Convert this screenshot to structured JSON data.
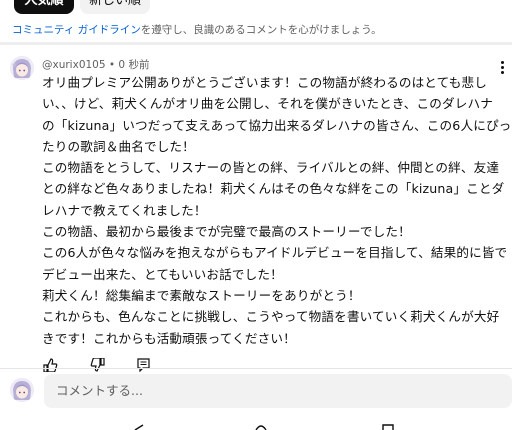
{
  "sort_chips": {
    "popular": "人気順",
    "newest": "新しい順"
  },
  "guidelines": {
    "link_text": "コミュニティ ガイドライン",
    "rest_text": "を遵守し、良識のあるコメントを心がけましょう。"
  },
  "comment": {
    "author": "@xurix0105",
    "separator": " • ",
    "time": "0 秒前",
    "lines": [
      "オリ曲プレミア公開ありがとうございます！この物語が終わるのはとても悲し",
      "い、、けど、莉犬くんがオリ曲を公開し、それを僕がきいたとき、このダレハナ",
      "の「kizuna」いつだって支えあって協力出来るダレハナの皆さん、この6人にぴっ",
      "たりの歌詞＆曲名でした！",
      "この物語をとうして、リスナーの皆との絆、ライバルとの絆、仲間との絆、友達",
      "との絆など色々ありましたね！莉犬くんはその色々な絆をこの「kizuna」ことダ",
      "レハナで教えてくれました！",
      "この物語、最初から最後までが完璧で最高のストーリーでした！",
      "この6人が色々な悩みを抱えながらもアイドルデビューを目指して、結果的に皆で",
      "デビュー出来た、とてもいいお話でした！",
      "莉犬くん！総集編まで素敵なストーリーをありがとう！",
      "これからも、色んなことに挑戦し、こうやって物語を書いていく莉犬くんが大好",
      "きです！これからも活動頑張ってください！"
    ]
  },
  "input": {
    "placeholder": "コメントする..."
  },
  "icons": {
    "like": "thumbs-up-icon",
    "dislike": "thumbs-down-icon",
    "reply": "reply-icon",
    "more": "more-vertical-icon"
  },
  "colors": {
    "link": "#065fd4",
    "chip_active": "#0f0f0f",
    "muted": "#606060"
  }
}
